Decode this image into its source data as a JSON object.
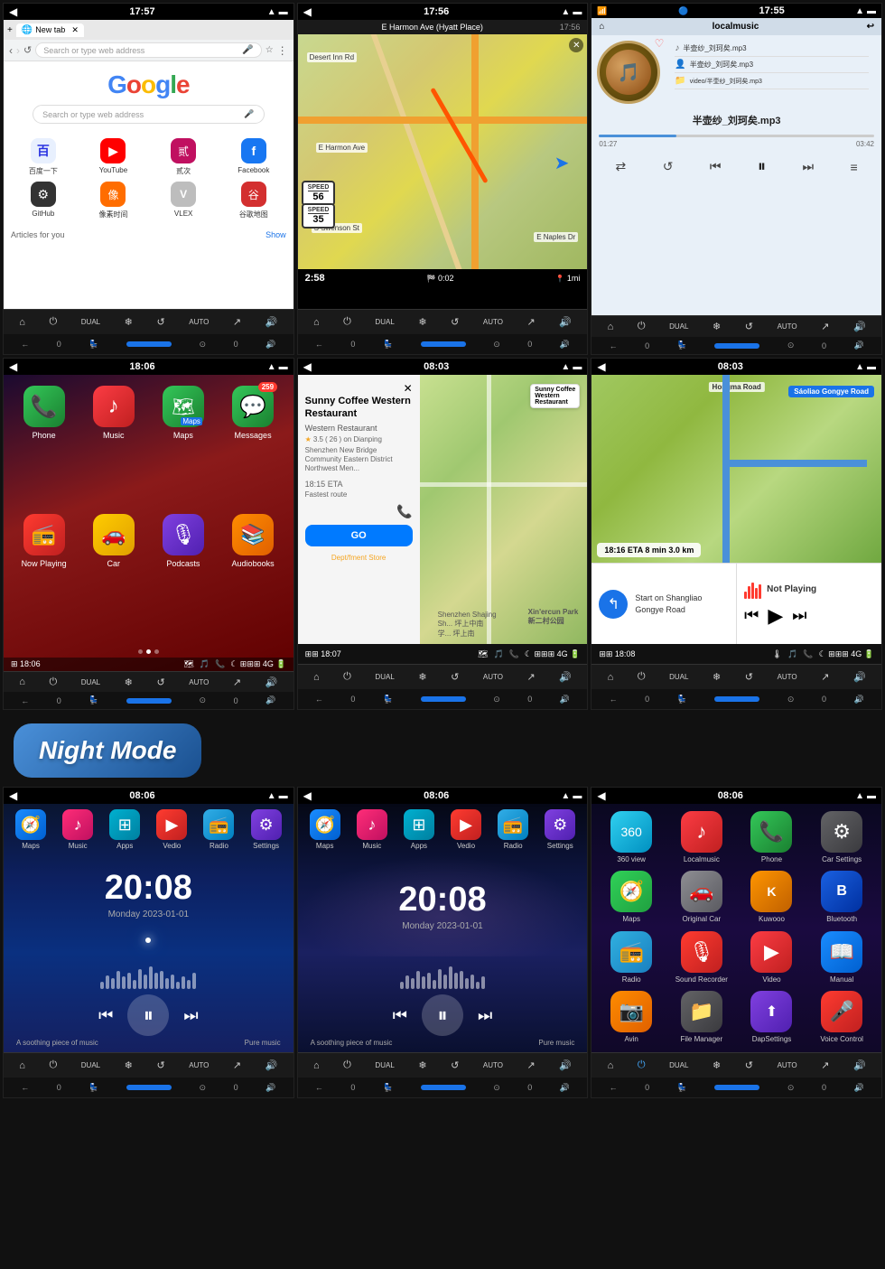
{
  "screens": {
    "row1": [
      {
        "id": "chrome",
        "status_time": "17:57",
        "title": "New tab",
        "address": "Search or type web address",
        "search_placeholder": "Search or type web address",
        "google_letters": [
          "G",
          "o",
          "o",
          "g",
          "l",
          "e"
        ],
        "shortcuts": [
          {
            "label": "百度一下",
            "icon": "🔵",
            "color": "blue"
          },
          {
            "label": "YouTube",
            "icon": "▶",
            "color": "red"
          },
          {
            "label": "贰次",
            "icon": "🔴",
            "color": "pink"
          },
          {
            "label": "Facebook",
            "icon": "f",
            "color": "blue2"
          },
          {
            "label": "GitHub",
            "icon": "⚫",
            "color": "dark"
          },
          {
            "label": "像素时间",
            "icon": "🟠",
            "color": "orange"
          },
          {
            "label": "VLEX",
            "icon": "V",
            "color": "gray"
          },
          {
            "label": "谷歌地图",
            "icon": "📍",
            "color": "red2"
          }
        ],
        "articles_label": "Articles for you",
        "show_label": "Show"
      },
      {
        "id": "navigation",
        "status_time": "17:56",
        "header_text": "E Harmon Ave (Hyatt Place)",
        "time1": "2:58",
        "time2": "0:02",
        "distance": "1mi",
        "speed_limit": "56",
        "speed_limit2": "35",
        "road_label": "E Harmon Ave"
      },
      {
        "id": "music",
        "status_time": "17:55",
        "header": "localmusic",
        "track1": "半壶纱_刘珂矣.mp3",
        "track2": "半壶纱_刘珂矣.mp3",
        "track3": "video/半壶纱_刘珂矣.mp3",
        "current_track": "半壶纱_刘珂矣.mp3",
        "current_time": "01:27",
        "total_time": "03:42"
      }
    ],
    "row2": [
      {
        "id": "carplay_home",
        "status_time": "18:06",
        "apps": [
          {
            "label": "Phone",
            "icon": "📞",
            "color": "green",
            "badge": ""
          },
          {
            "label": "Music",
            "icon": "♪",
            "color": "red"
          },
          {
            "label": "Maps",
            "icon": "🗺",
            "color": "green"
          },
          {
            "label": "Messages",
            "icon": "💬",
            "color": "green",
            "badge": "259"
          },
          {
            "label": "Now Playing",
            "icon": "⏵",
            "color": "red2"
          },
          {
            "label": "Car",
            "icon": "🚗",
            "color": "yellow"
          },
          {
            "label": "Podcasts",
            "icon": "🎙",
            "color": "purple"
          },
          {
            "label": "Audiobooks",
            "icon": "📚",
            "color": "orange"
          }
        ],
        "status_time2": "18:06",
        "signal": "4G"
      },
      {
        "id": "carplay_nav",
        "status_time": "08:03",
        "place_name": "Sunny Coffee Western Restaurant",
        "place_type": "Western Restaurant",
        "rating": "3.5",
        "review_count": "26",
        "review_source": "Dianping",
        "address": "Shenzhen New Bridge Community Eastern District Northwest Men...",
        "eta": "18:15",
        "route_type": "Fastest route",
        "go_label": "GO",
        "phone_icon": "📞"
      },
      {
        "id": "carplay_split",
        "status_time": "08:03",
        "road_name": "Sáoliao Gongye Road",
        "eta": "18:16",
        "eta_mins": "8 min",
        "eta_dist": "3.0 km",
        "nav_instruction": "Start on Shangliao Gongye Road",
        "music_status": "Not Playing"
      }
    ],
    "night_label": "Night Mode",
    "row3": [
      {
        "id": "night1",
        "status_time": "08:06",
        "apps": [
          {
            "label": "Maps",
            "icon": "🧭",
            "color": "blue"
          },
          {
            "label": "Music",
            "icon": "♪",
            "color": "pink"
          },
          {
            "label": "Apps",
            "icon": "⊞",
            "color": "teal"
          },
          {
            "label": "Vedio",
            "icon": "▶",
            "color": "red"
          },
          {
            "label": "Radio",
            "icon": "📻",
            "color": "cyan"
          },
          {
            "label": "Settings",
            "icon": "⚙",
            "color": "purple"
          }
        ],
        "time": "20:08",
        "date": "Monday  2023-01-01",
        "music_label1": "A soothing piece of music",
        "music_label2": "Pure music"
      },
      {
        "id": "night2",
        "status_time": "08:06",
        "apps": [
          {
            "label": "Maps",
            "icon": "🧭",
            "color": "blue"
          },
          {
            "label": "Music",
            "icon": "♪",
            "color": "pink"
          },
          {
            "label": "Apps",
            "icon": "⊞",
            "color": "teal"
          },
          {
            "label": "Vedio",
            "icon": "▶",
            "color": "red"
          },
          {
            "label": "Radio",
            "icon": "📻",
            "color": "cyan"
          },
          {
            "label": "Settings",
            "icon": "⚙",
            "color": "purple"
          }
        ],
        "time": "20:08",
        "date": "Monday  2023-01-01",
        "music_label1": "A soothing piece of music",
        "music_label2": "Pure music"
      },
      {
        "id": "appgrid",
        "status_time": "08:06",
        "apps": [
          {
            "label": "360 view",
            "icon": "🔵",
            "color": "360"
          },
          {
            "label": "Localmusic",
            "icon": "♪",
            "color": "music"
          },
          {
            "label": "Phone",
            "icon": "📞",
            "color": "phone"
          },
          {
            "label": "Car Settings",
            "icon": "⚙",
            "color": "settings"
          },
          {
            "label": "Maps",
            "icon": "🧭",
            "color": "maps"
          },
          {
            "label": "Original Car",
            "icon": "🚗",
            "color": "car"
          },
          {
            "label": "Kuwooo",
            "icon": "K",
            "color": "kuwo"
          },
          {
            "label": "Bluetooth",
            "icon": "B",
            "color": "bt2"
          },
          {
            "label": "Radio",
            "icon": "📻",
            "color": "radio"
          },
          {
            "label": "Sound Recorder",
            "icon": "🎙",
            "color": "sound"
          },
          {
            "label": "Video",
            "icon": "▶",
            "color": "video"
          },
          {
            "label": "Manual",
            "icon": "📖",
            "color": "manual"
          },
          {
            "label": "Avin",
            "icon": "📷",
            "color": "avin"
          },
          {
            "label": "File Manager",
            "icon": "📁",
            "color": "filemgr"
          },
          {
            "label": "DapSettings",
            "icon": "⬆",
            "color": "dap"
          },
          {
            "label": "Voice Control",
            "icon": "🎤",
            "color": "voice"
          }
        ]
      }
    ]
  },
  "controls": {
    "home_icon": "⌂",
    "power_icon": "⏻",
    "dual_label": "DUAL",
    "snowflake_icon": "❄",
    "loop_icon": "↺",
    "auto_label": "AUTO",
    "curve_icon": "↗",
    "volume_icon": "🔊",
    "back_icon": "←",
    "zero": "0",
    "forward_icon": "→"
  }
}
